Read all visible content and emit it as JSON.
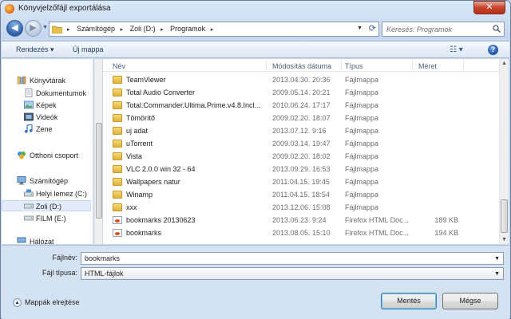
{
  "window": {
    "title": "Könyvjelzőfájl exportálása",
    "close_label": "✕"
  },
  "address": {
    "crumbs": [
      "Számítógép",
      "Zoli (D:)",
      "Programok"
    ],
    "search_placeholder": "Keresés: Programok"
  },
  "toolbar": {
    "organize": "Rendezés ▾",
    "new_folder": "Új mappa",
    "views": "☷ ▾",
    "help": "?"
  },
  "nav": {
    "items": [
      {
        "label": "Könyvtárak",
        "icon": "libraries-icon"
      },
      {
        "label": "Dokumentumok",
        "icon": "documents-icon"
      },
      {
        "label": "Képek",
        "icon": "pictures-icon"
      },
      {
        "label": "Videók",
        "icon": "videos-icon"
      },
      {
        "label": "Zene",
        "icon": "music-icon"
      },
      {
        "label": "Otthoni csoport",
        "icon": "homegroup-icon"
      },
      {
        "label": "Számítógép",
        "icon": "computer-icon"
      },
      {
        "label": "Helyi lemez (C:)",
        "icon": "drive-icon"
      },
      {
        "label": "Zoli (D:)",
        "icon": "drive-icon"
      },
      {
        "label": "FILM (E:)",
        "icon": "drive-icon"
      },
      {
        "label": "Hálózat",
        "icon": "network-icon"
      }
    ]
  },
  "columns": {
    "name": "Név",
    "date": "Módosítás dátuma",
    "type": "Típus",
    "size": "Méret"
  },
  "files": [
    {
      "name": "TeamViewer",
      "date": "2013.04.30. 20:36",
      "type": "Fájlmappa",
      "size": "",
      "kind": "folder"
    },
    {
      "name": "Total Audio Converter",
      "date": "2009.05.14. 20:21",
      "type": "Fájlmappa",
      "size": "",
      "kind": "folder"
    },
    {
      "name": "Total.Commander.Ultima.Prime.v4.8.Incl...",
      "date": "2010.06.24. 17:17",
      "type": "Fájlmappa",
      "size": "",
      "kind": "folder"
    },
    {
      "name": "Tömörítő",
      "date": "2009.02.20. 18:07",
      "type": "Fájlmappa",
      "size": "",
      "kind": "folder"
    },
    {
      "name": "uj adat",
      "date": "2013.07.12. 9:16",
      "type": "Fájlmappa",
      "size": "",
      "kind": "folder"
    },
    {
      "name": "uTorrent",
      "date": "2009.03.14. 19:47",
      "type": "Fájlmappa",
      "size": "",
      "kind": "folder"
    },
    {
      "name": "Vista",
      "date": "2009.02.20. 18:02",
      "type": "Fájlmappa",
      "size": "",
      "kind": "folder"
    },
    {
      "name": "VLC 2.0.0 win 32 - 64",
      "date": "2013.09.29. 16:53",
      "type": "Fájlmappa",
      "size": "",
      "kind": "folder"
    },
    {
      "name": "Wallpapers natur",
      "date": "2011.04.15. 19:45",
      "type": "Fájlmappa",
      "size": "",
      "kind": "folder"
    },
    {
      "name": "Winamp",
      "date": "2011.04.15. 18:54",
      "type": "Fájlmappa",
      "size": "",
      "kind": "folder"
    },
    {
      "name": "xxx",
      "date": "2013.12.06. 15:08",
      "type": "Fájlmappa",
      "size": "",
      "kind": "folder"
    },
    {
      "name": "bookmarks 20130623",
      "date": "2013.06.23. 9:24",
      "type": "Firefox HTML Doc...",
      "size": "189 KB",
      "kind": "html"
    },
    {
      "name": "bookmarks",
      "date": "2013.08.05. 15:10",
      "type": "Firefox HTML Doc...",
      "size": "194 KB",
      "kind": "html"
    }
  ],
  "form": {
    "filename_label": "Fájlnév:",
    "filename_value": "bookmarks",
    "filetype_label": "Fájl típusa:",
    "filetype_value": "HTML-fájlok",
    "hide_folders": "Mappák elrejtése",
    "save": "Mentés",
    "cancel": "Mégse"
  }
}
